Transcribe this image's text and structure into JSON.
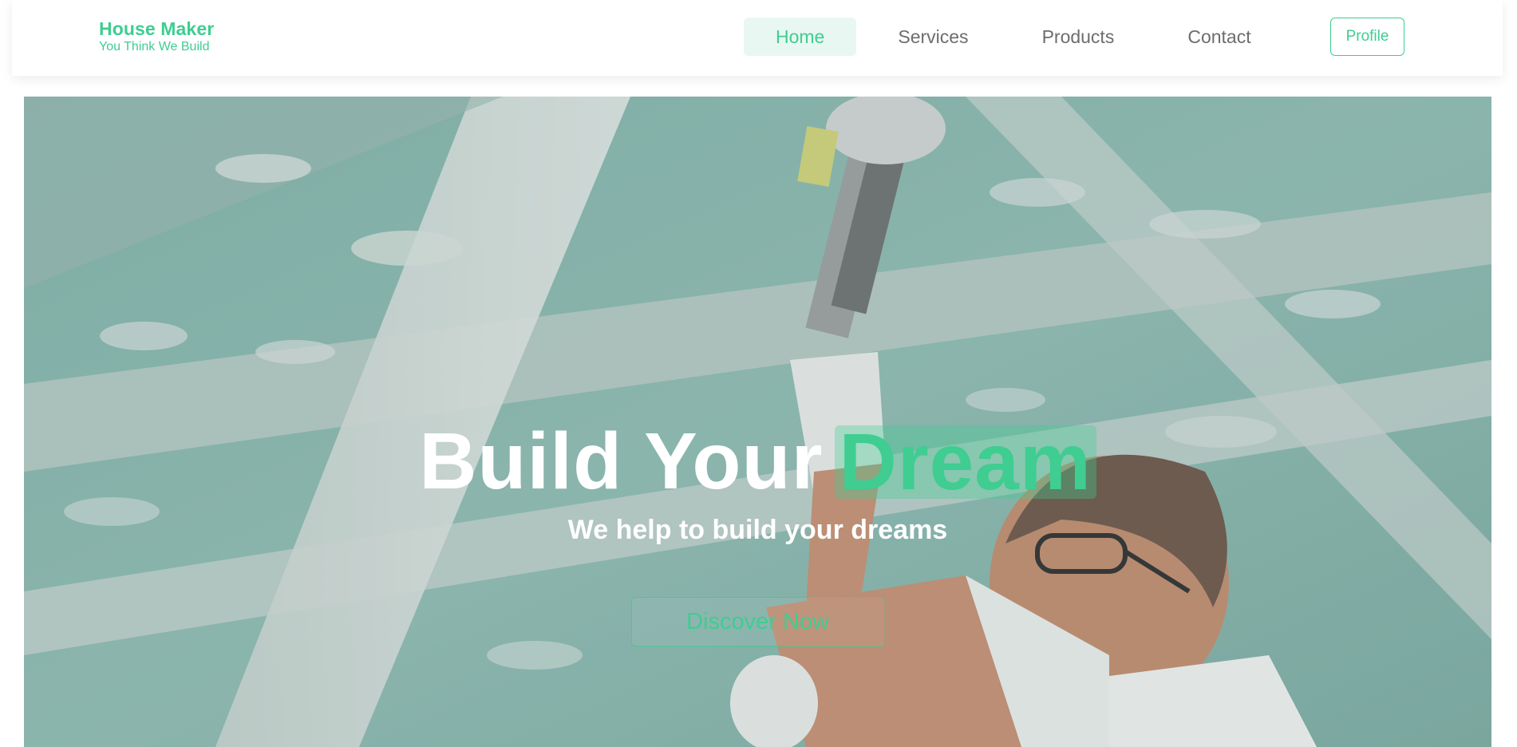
{
  "brand": {
    "name": "House Maker",
    "tagline": "You Think We Build"
  },
  "nav": {
    "items": [
      {
        "label": "Home",
        "active": true
      },
      {
        "label": "Services",
        "active": false
      },
      {
        "label": "Products",
        "active": false
      },
      {
        "label": "Contact",
        "active": false
      }
    ],
    "profile_label": "Profile"
  },
  "hero": {
    "headline_main": "Build Your",
    "headline_accent": "Dream",
    "subheadline": "We help to build your dreams",
    "cta_label": "Discover Now",
    "image_description_icon": "construction-worker-photo"
  },
  "colors": {
    "accent": "#3fcd91",
    "nav_active_bg": "#e9f7f2",
    "nav_text": "#6d6d6d",
    "hero_tint": "#8fb9b0"
  }
}
